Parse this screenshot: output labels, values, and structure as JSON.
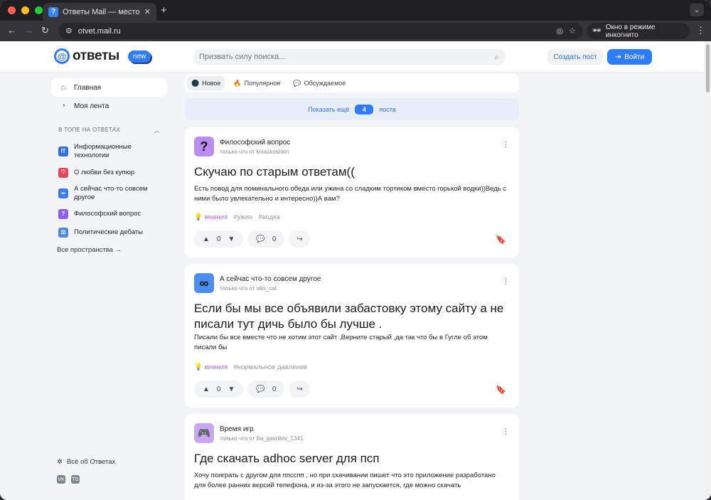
{
  "browser": {
    "tab_title": "Ответы Mail — место для об",
    "url": "otvet.mail.ru",
    "incognito_label": "Окно в режиме инкогнито",
    "traffic_lights": [
      "#ff5f57",
      "#febc2e",
      "#28c840"
    ]
  },
  "header": {
    "logo_text": "ответы",
    "logo_badge": "new",
    "search_placeholder": "Призвать силу поиска...",
    "create_post": "Создать пост",
    "login": "Войти"
  },
  "sidebar": {
    "nav": [
      {
        "label": "Главная",
        "icon": "home-icon"
      },
      {
        "label": "Моя лента",
        "icon": "feed-icon"
      }
    ],
    "top_heading": "В ТОПЕ НА ОТВЕТАХ",
    "spaces": [
      {
        "label": "Информационные технологии",
        "icon": "IT",
        "color": "#2f6fe0"
      },
      {
        "label": "О любви без купюр",
        "icon": "♡",
        "color": "#e0475b"
      },
      {
        "label": "А сейчас что-то совсем другое",
        "icon": "∞",
        "color": "#3d7be8"
      },
      {
        "label": "Философский вопрос",
        "icon": "?",
        "color": "#8b5cf6"
      },
      {
        "label": "Политические дебаты",
        "icon": "⚖",
        "color": "#4f8ad8"
      }
    ],
    "all_spaces": "Все пространства →",
    "about": "Всё об Ответах",
    "socials": [
      "VK",
      "TG"
    ]
  },
  "feed": {
    "tabs": [
      {
        "label": "Новое",
        "icon": "🌑"
      },
      {
        "label": "Популярное",
        "icon": "🔥"
      },
      {
        "label": "Обсуждаемое",
        "icon": "💬"
      }
    ],
    "show_more_prefix": "Показать ещё",
    "show_more_count": "4",
    "show_more_suffix": "поста",
    "cards": [
      {
        "space": "Философский вопрос",
        "meta": "только что от kniazkoshkin",
        "avatar": "?",
        "avatar_color": "#b98cf0",
        "title": "Скучаю по старым ответам((",
        "text": "Есть повод для поминального обеда или ужина со сладким тортиком вместо горькой водки))Ведь с ними было увлекательно и интересно))А вам?",
        "tags": [
          "мнения",
          "#ужин",
          "#водка"
        ],
        "votes": "0",
        "comments": "0"
      },
      {
        "space": "А сейчас что-то совсем другое",
        "meta": "только что от vikii_cat",
        "avatar": "∞",
        "avatar_color": "#4d8cf0",
        "title": "Если бы мы все объявили забастовку этому сайту а не писали тут дичь было бы лучше .",
        "text": "Писали бы все вместе что не хотим этот сайт ,Верните старый ,да так что бы в Гугле об этом писали бы",
        "tags": [
          "мнения",
          "#нормальное давление"
        ],
        "votes": "0",
        "comments": "0"
      },
      {
        "space": "Время игр",
        "meta": "только что от ilia_gavriilov_1341",
        "avatar": "🎮",
        "avatar_color": "#c9a7f4",
        "title": "Где скачать adhoc server для псп",
        "text": "Хочу поиграть с другом для ппсспп , но при скачивании пишет что это приложение разработано для более ранних версий телефона, и из-за этого не запускается, где можно скачать"
      }
    ]
  }
}
